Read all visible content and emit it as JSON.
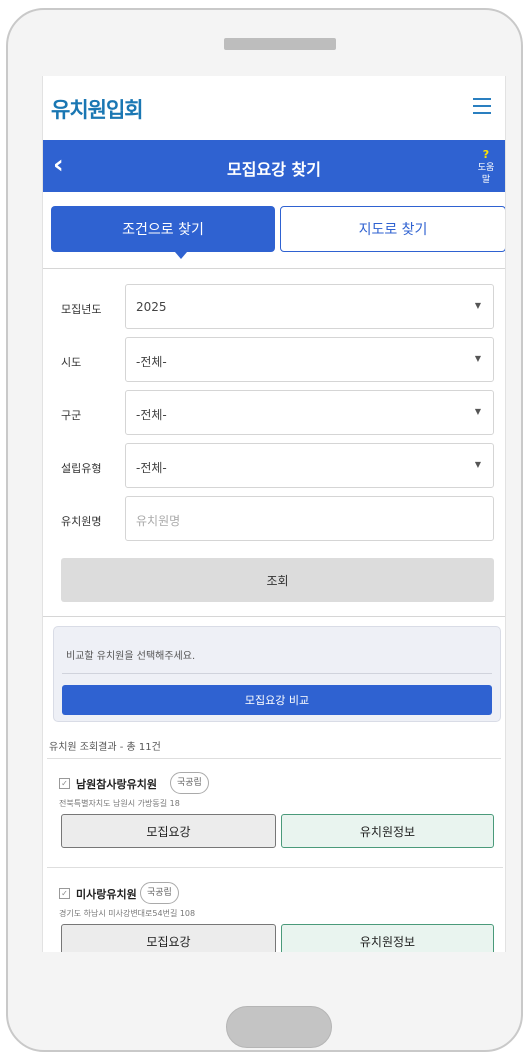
{
  "header": {
    "brand": "유치원입회",
    "menu_icon": "hamburger-icon"
  },
  "title_bar": {
    "back_icon": "chevron-left-icon",
    "title": "모집요강 찾기",
    "help_icon_glyph": "?",
    "help_label": "도움말"
  },
  "tabs": [
    {
      "label": "조건으로 찾기",
      "active": true
    },
    {
      "label": "지도로 찾기",
      "active": false
    }
  ],
  "form": {
    "year": {
      "label": "모집년도",
      "value": "2025"
    },
    "sido": {
      "label": "시도",
      "value": "-전체-"
    },
    "gugun": {
      "label": "구군",
      "value": "-전체-"
    },
    "type": {
      "label": "설립유형",
      "value": "-전체-"
    },
    "name": {
      "label": "유치원명",
      "placeholder": "유치원명"
    },
    "search_label": "조회"
  },
  "compare": {
    "hint": "비교할 유치원을 선택해주세요.",
    "button_label": "모집요강 비교"
  },
  "results": {
    "summary": "유치원 조회결과 - 총 11건",
    "items": [
      {
        "name": "남원참사랑유치원",
        "badge": "국공립",
        "address": "전북특별자치도 남원시 가방동길 18",
        "guide_label": "모집요강",
        "info_label": "유치원정보"
      },
      {
        "name": "미사랑유치원",
        "badge": "국공립",
        "address": "경기도 하남시 미사강변대로54번길 108",
        "guide_label": "모집요강",
        "info_label": "유치원정보"
      }
    ]
  },
  "colors": {
    "primary": "#2f62d1",
    "brand": "#1a77b3",
    "info_border": "#4a9a7a"
  }
}
